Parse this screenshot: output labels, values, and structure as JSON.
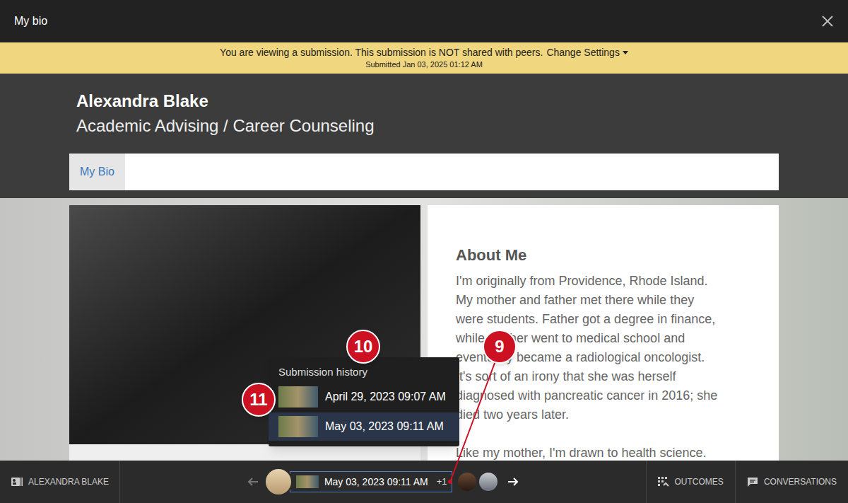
{
  "window": {
    "title": "My bio"
  },
  "banner": {
    "message": "You are viewing a submission. This submission is NOT shared with peers.",
    "settings_link": "Change Settings",
    "submitted": "Submitted Jan 03, 2025 01:12 AM"
  },
  "profile": {
    "name": "Alexandra Blake",
    "role": "Academic Advising / Career Counseling"
  },
  "tabs": [
    {
      "label": "My Bio",
      "selected": true
    }
  ],
  "about": {
    "heading": "About Me",
    "paragraphs": [
      [
        "I'm originally from Providence, Rhode Island.",
        "My mother and father met there while they",
        "were students. Father got a degree in finance,",
        "while mother went to medical school and",
        "eventually became a radiological oncologist.",
        "It's sort of an irony that she was herself",
        "diagnosed with pancreatic cancer in 2016; she",
        "died two years later."
      ],
      [
        "Like my mother, I'm drawn to health science."
      ]
    ]
  },
  "footer": {
    "student": "ALEXANDRA BLAKE",
    "current_submission": {
      "date": "May 03, 2023 09:11 AM",
      "more": "+1"
    },
    "actions": [
      "OUTCOMES",
      "CONVERSATIONS"
    ]
  },
  "history": {
    "title": "Submission history",
    "items": [
      {
        "date": "April 29, 2023 09:07 AM",
        "selected": false
      },
      {
        "date": "May 03, 2023 09:11 AM",
        "selected": true
      }
    ]
  },
  "callouts": [
    {
      "label": "9"
    },
    {
      "label": "10"
    },
    {
      "label": "11"
    }
  ]
}
